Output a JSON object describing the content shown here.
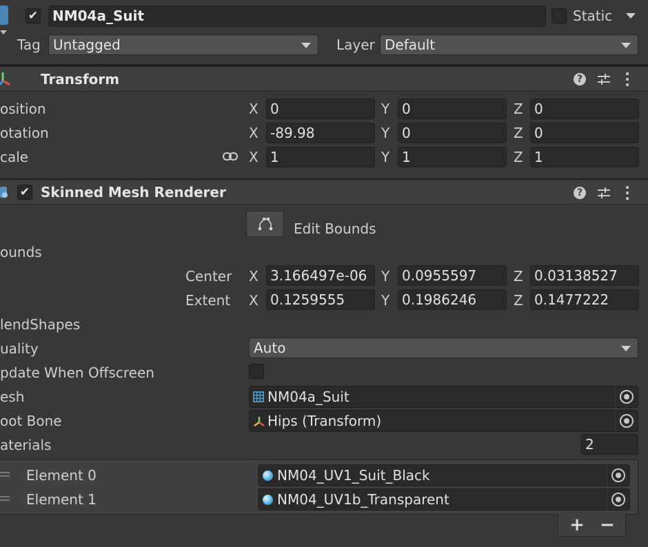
{
  "object": {
    "name": "NM04a_Suit",
    "enabled": true,
    "static_label": "Static",
    "static": false
  },
  "tag": {
    "label": "Tag",
    "value": "Untagged"
  },
  "layer": {
    "label": "Layer",
    "value": "Default"
  },
  "transform": {
    "title": "Transform",
    "rows": [
      {
        "label": "osition",
        "x": "0",
        "y": "0",
        "z": "0"
      },
      {
        "label": "otation",
        "x": "-89.98",
        "y": "0",
        "z": "0"
      },
      {
        "label": "cale",
        "x": "1",
        "y": "1",
        "z": "1"
      }
    ]
  },
  "axes": {
    "x": "X",
    "y": "Y",
    "z": "Z"
  },
  "renderer": {
    "title": "Skinned Mesh Renderer",
    "enabled": true,
    "edit_bounds": "Edit Bounds",
    "bounds_label": "ounds",
    "center": {
      "label": "Center",
      "x": "3.166497e-06",
      "y": "0.0955597",
      "z": "0.03138527"
    },
    "extent": {
      "label": "Extent",
      "x": "0.1259555",
      "y": "0.1986246",
      "z": "0.1477222"
    },
    "blendshapes_label": "lendShapes",
    "quality": {
      "label": "uality",
      "value": "Auto"
    },
    "update_offscreen": {
      "label": "pdate When Offscreen",
      "checked": false
    },
    "mesh": {
      "label": "esh",
      "value": "NM04a_Suit"
    },
    "root_bone": {
      "label": "oot Bone",
      "value": "Hips (Transform)"
    },
    "materials": {
      "label": "aterials",
      "count": "2",
      "elements": [
        {
          "label": "Element 0",
          "value": "NM04_UV1_Suit_Black"
        },
        {
          "label": "Element 1",
          "value": "NM04_UV1b_Transparent"
        }
      ],
      "add": "+",
      "remove": "−"
    }
  },
  "colors": {
    "background": "#383838",
    "field": "#2a2a2a",
    "header": "#3e3e3e",
    "accent": "#5ab4e6"
  }
}
